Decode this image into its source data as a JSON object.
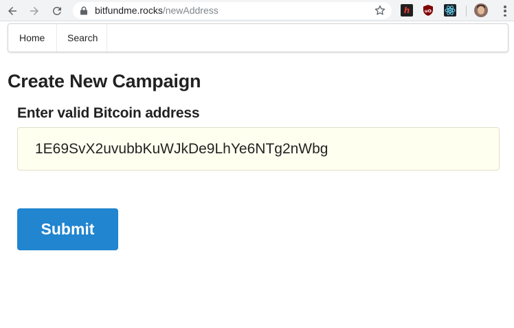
{
  "browser": {
    "url_host": "bitfundme.rocks",
    "url_path": "/newAddress",
    "extensions": [
      "lastpass-icon",
      "ublock-origin-icon",
      "react-devtools-icon"
    ]
  },
  "nav_menu": {
    "items": [
      {
        "label": "Home"
      },
      {
        "label": "Search"
      }
    ]
  },
  "page": {
    "title": "Create New Campaign",
    "form": {
      "address_label": "Enter valid Bitcoin address",
      "address_value": "1E69SvX2uvubbKuWJkDe9LhYe6NTg2nWbg",
      "submit_label": "Submit"
    }
  },
  "colors": {
    "primary_button": "#2185d0",
    "input_background": "#fffff0",
    "chrome_background": "#f1f3f4"
  }
}
